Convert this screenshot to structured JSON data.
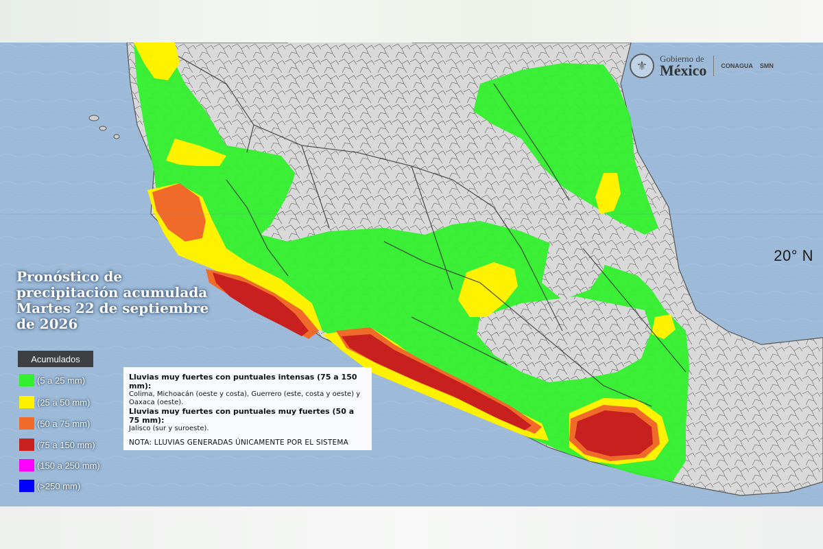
{
  "title": {
    "line1": "Pronóstico de",
    "line2": "precipitación acumulada",
    "line3": "Martes 22 de septiembre",
    "line4": "de 2026"
  },
  "logo": {
    "gobierno_small": "Gobierno de",
    "gobierno_big": "México",
    "agency1": "CONAGUA",
    "agency2": "SMN",
    "seal_icon": "national-seal-icon"
  },
  "map": {
    "latitude_label": "20° N",
    "colors": {
      "ocean": "#9dbad9",
      "land": "#d9d9d9",
      "green": "#33f02e",
      "yellow": "#fff200",
      "orange": "#f06a2a",
      "red": "#c8201e"
    }
  },
  "legend": {
    "header": "Acumulados",
    "items": [
      {
        "label": "(5 a 25 mm)",
        "color": "#33f02e"
      },
      {
        "label": "(25 a 50 mm)",
        "color": "#fff200"
      },
      {
        "label": "(50 a 75 mm)",
        "color": "#f06a2a"
      },
      {
        "label": "(75 a 150 mm)",
        "color": "#c8201e"
      },
      {
        "label": "(150 a 250 mm)",
        "color": "#ff00ff"
      },
      {
        "label": "(>250 mm)",
        "color": "#0000ff"
      }
    ]
  },
  "forecast_note": {
    "heading1": "Lluvias muy fuertes con puntuales intensas (75 a 150 mm):",
    "detail1": "Colima, Michoacán (oeste y costa), Guerrero (este, costa y oeste) y Oaxaca (oeste).",
    "heading2": "Lluvias muy fuertes con puntuales muy fuertes (50 a 75 mm):",
    "detail2": "Jalisco (sur y suroeste).",
    "note": "NOTA: LLUVIAS GENERADAS ÚNICAMENTE POR EL SISTEMA"
  }
}
